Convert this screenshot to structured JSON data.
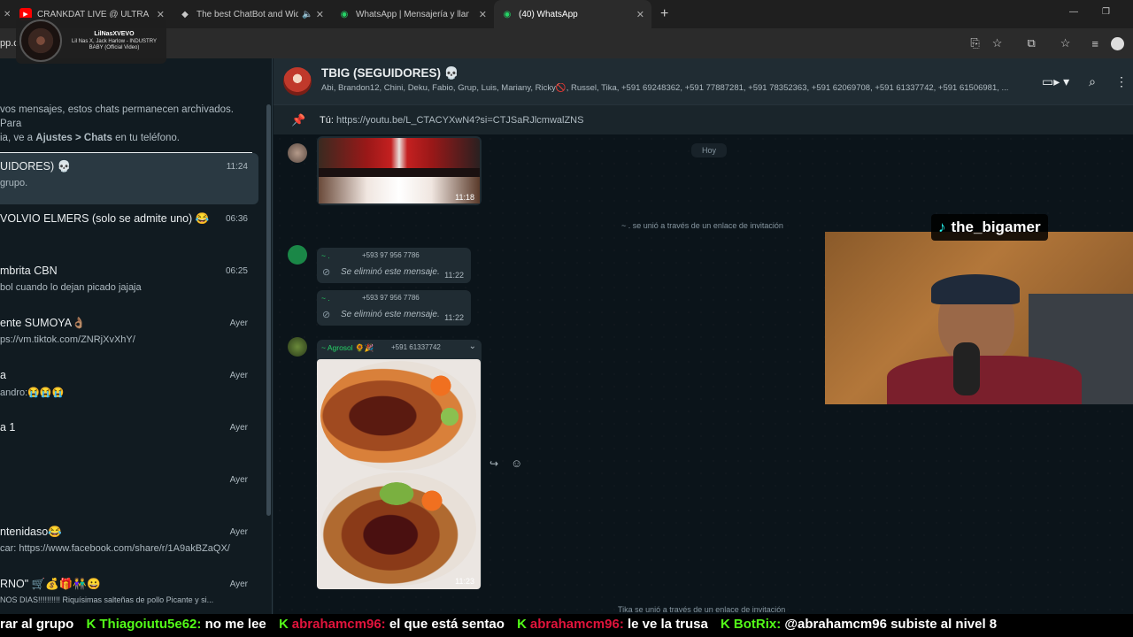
{
  "browser": {
    "tabs": [
      {
        "title": "CRANKDAT LIVE @ ULTRA MUS",
        "icon": "youtube-icon"
      },
      {
        "title": "The best ChatBot and Widg",
        "icon": "chatbot-icon"
      },
      {
        "title": "WhatsApp | Mensajería y llama",
        "icon": "whatsapp-icon"
      },
      {
        "title": "(40) WhatsApp",
        "icon": "whatsapp-icon"
      }
    ],
    "new_tab": "+",
    "address_prefix": "pp.c"
  },
  "music_overlay": {
    "artist": "LilNasXVEVO",
    "track": "Lil Nas X, Jack Harlow - INDUSTRY BABY (Official Video)"
  },
  "sidebar": {
    "archived_note_prefix": "vos mensajes, estos chats permanecen archivados. Para",
    "archived_note_middle": "ia, ve a ",
    "archived_note_bold": "Ajustes > Chats",
    "archived_note_suffix": " en tu teléfono.",
    "chats": [
      {
        "name": "UIDORES) 💀",
        "preview": "grupo.",
        "time": "11:24"
      },
      {
        "name": "VOLVIO ELMERS (solo se admite uno) 😂",
        "preview": "",
        "time": "06:36"
      },
      {
        "name": "mbrita CBN",
        "preview": "bol cuando lo dejan picado jajaja",
        "time": "06:25"
      },
      {
        "name": "ente SUMOYA👌🏽",
        "preview": "ps://vm.tiktok.com/ZNRjXvXhY/",
        "time": "Ayer"
      },
      {
        "name": "a",
        "preview": "andro:😭😭😭",
        "time": "Ayer"
      },
      {
        "name": "a 1",
        "preview": "",
        "time": "Ayer"
      },
      {
        "name": "",
        "preview": "",
        "time": "Ayer"
      },
      {
        "name": "ntenidaso😂",
        "preview": "car: https://www.facebook.com/share/r/1A9akBZaQX/",
        "time": "Ayer"
      },
      {
        "name": "RNO\" 🛒💰🎁👫😀",
        "preview": "NOS DIAS!!!!!!!!!! Riquísimas salteñas de pollo Picante y si...",
        "time": "Ayer"
      }
    ]
  },
  "chat": {
    "title": "TBIG (SEGUIDORES) 💀",
    "members": "Abi, Brandon12, Chini, Deku, Fabio, Grup, Luis, Mariany, Ricky🚫, Russel, Tika, +591 69248362, +591 77887281, +591 78352363, +591 62069708, +591 61337742, +591 61506981, ...",
    "pinned_prefix": "Tú:",
    "pinned_text": "https://youtu.be/L_CTACYXwN4?si=CTJSaRJlcmwalZNS",
    "day_chip": "Hoy",
    "messages": [
      {
        "kind": "image",
        "time": "11:18"
      },
      {
        "kind": "system",
        "text": "~ . se unió a través de un enlace de invitación"
      },
      {
        "kind": "deleted",
        "sender": "~ .",
        "phone": "+593 97 956 7786",
        "text": "Se eliminó este mensaje.",
        "time": "11:22"
      },
      {
        "kind": "deleted",
        "sender": "~ .",
        "phone": "+593 97 956 7786",
        "text": "Se eliminó este mensaje.",
        "time": "11:22"
      },
      {
        "kind": "image",
        "sender": "~ Agrosol 🌻🎉",
        "phone": "+591 61337742",
        "time": "11:23"
      },
      {
        "kind": "system",
        "text": "Tika se unió a través de un enlace de invitación"
      }
    ]
  },
  "stream": {
    "tiktok_handle": "the_bigamer",
    "ticker": [
      {
        "user": "",
        "msg": "rar al grupo"
      },
      {
        "user": "Thiagoiutu5e62:",
        "msg": "no me lee",
        "color": "green"
      },
      {
        "user": "abrahamcm96:",
        "msg": "el que está sentao",
        "color": "red"
      },
      {
        "user": "abrahamcm96:",
        "msg": "le ve la trusa",
        "color": "red"
      },
      {
        "user": "BotRix:",
        "msg": "@abrahamcm96 subiste al nivel 8",
        "color": "green"
      }
    ]
  },
  "colors": {
    "panel": "#202c33",
    "background": "#0b141a",
    "accent_green": "#25d366",
    "ticker_red": "#e0143c",
    "ticker_green": "#53fc18"
  }
}
